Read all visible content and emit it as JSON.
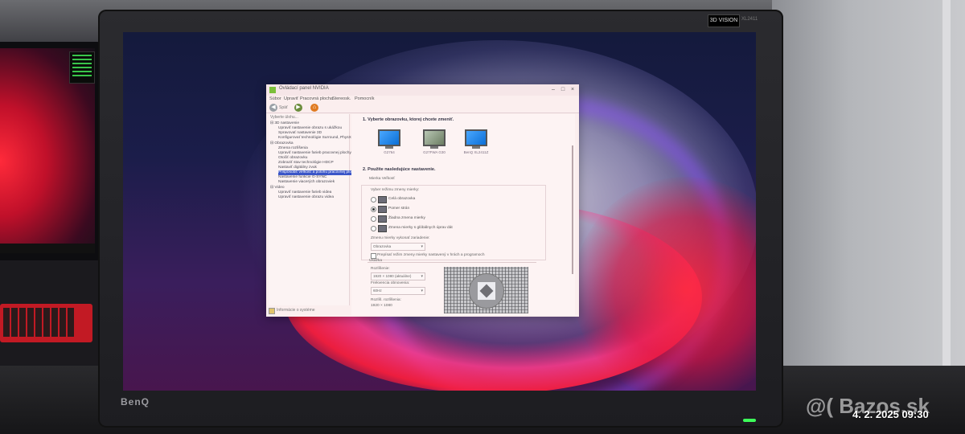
{
  "photo": {
    "monitor_brand": "BenQ",
    "monitor_badge": "3D VISION",
    "monitor_model": "XL2411",
    "watermark": "@( Bazos.sk",
    "timestamp": "4. 2. 2025  09:30"
  },
  "window": {
    "title": "Ovládací panel NVIDIA",
    "controls": [
      "–",
      "□",
      "×"
    ],
    "menu": [
      "Súbor",
      "Upraviť",
      "Pracovná plocha",
      "Stereosk.",
      "Pomocník"
    ],
    "toolbar": {
      "back_label": "Späť"
    },
    "sidebar": {
      "header": "Vyberte úlohu...",
      "items": [
        "⊟ 3D nastavenie",
        "Upraviť nastavenie obrazu s ukážkou",
        "Spravovať nastavenie 3D",
        "Konfigurovať technológie Surround, PhysX",
        "⊟ Obrazovka",
        "Zmena rozlíšenia",
        "Upraviť nastavenie farieb pracovnej plochy",
        "Otočiť obrazovku",
        "Zobraziť stav technológie HDCP",
        "Nastaviť digitálny zvuk",
        "Prispôsobiť veľkosť a polohu pracovnej plochy",
        "Nastavenie funkcie G-SYNC",
        "Nastavenie viacerých obrazoviek",
        "⊟ Video",
        "Upraviť nastavenie farieb videa",
        "Upraviť nastavenie obrazu videa"
      ],
      "selected_index": 10,
      "footer": "Informácie o systéme"
    },
    "main": {
      "section1_title": "1. Vyberte obrazovku, ktorej chcete zmeniť.",
      "displays": [
        "G2764",
        "G27FWA G30",
        "BenQ XL2411Z"
      ],
      "section2_title": "2. Použite nasledujúce nastavenie.",
      "tabs_label": "Mierka     Veľkosť",
      "scaling_label": "Vyber režimu zmeny mierky:",
      "scaling_options": [
        "Celá obrazovka",
        "Pomer strán",
        "Žiadna zmena mierky",
        "Zmena mierky s glóbálnych úprav dát"
      ],
      "scaling_selected_index": 1,
      "perform_on_label": "Zmenu mierky vykonať zariadenie:",
      "perform_on_value": "Obrazovka",
      "override_checkbox": "Prepísať režim zmeny mierky nastavený v hrách a programoch",
      "preview_label": "Ukážka",
      "resolution_label": "Rozlíšenie:",
      "resolution_value": "1920 × 1080 (aktuálne)",
      "refresh_label": "Frekvencia obnovenia:",
      "refresh_value": "60Hz",
      "desktop_res_label": "Rozlíš. rozlíšenia:",
      "desktop_res_value": "1920 × 1080"
    }
  }
}
